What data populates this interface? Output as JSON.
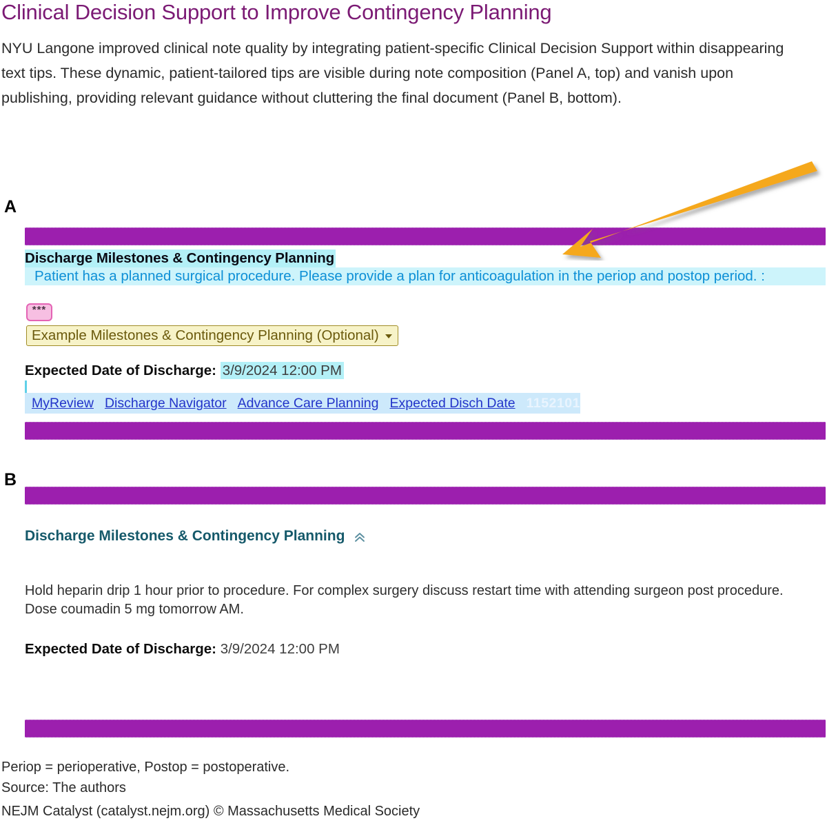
{
  "header": {
    "title": "Clinical Decision Support to Improve Contingency Planning",
    "intro": "NYU Langone improved clinical note quality by integrating patient-specific Clinical Decision Support within disappearing text tips. These dynamic, patient-tailored tips are visible during note composition (Panel A, top) and vanish upon publishing, providing relevant guidance without cluttering the final document (Panel B, bottom)."
  },
  "panels": {
    "a": {
      "letter": "A",
      "heading": "Discharge Milestones & Contingency Planning",
      "cds_tip": "Patient has a planned surgical procedure. Please provide a plan for anticoagulation in the periop and postop period.  :",
      "placeholder_token": "***",
      "dropdown_label": "Example Milestones & Contingency Planning (Optional)",
      "dropdown_caret": "chevron-down-icon",
      "edd_label": "Expected Date of Discharge:",
      "edd_value": "3/9/2024 12:00 PM",
      "links": [
        "MyReview",
        "Discharge Navigator",
        "Advance Care Planning",
        "Expected Disch Date"
      ],
      "faint_id": "1152101"
    },
    "b": {
      "letter": "B",
      "heading": "Discharge Milestones & Contingency Planning",
      "collapse_icon": "chevron-up-icon",
      "body": "Hold heparin drip 1 hour prior to procedure. For complex surgery discuss restart time with attending surgeon post procedure. Dose coumadin 5 mg tomorrow AM.",
      "edd_label": "Expected Date of Discharge:",
      "edd_value": "3/9/2024 12:00 PM"
    }
  },
  "annotation": {
    "arrow": "arrow-pointing-down-left",
    "arrow_color": "#F5A81C"
  },
  "footer": {
    "abbreviations": "Periop = perioperative, Postop = postoperative.",
    "source": "Source: The authors",
    "credit": "NEJM Catalyst (catalyst.nejm.org) © Massachusetts Medical Society"
  },
  "colors": {
    "title_purple": "#7B1A74",
    "bar_purple": "#9C1FAE",
    "cds_tip_blue": "#0D8FD6",
    "cds_highlight": "#CDF4FB",
    "teal_heading": "#15596A",
    "link_blue": "#2234C9",
    "arrow_gold": "#F5A81C"
  }
}
